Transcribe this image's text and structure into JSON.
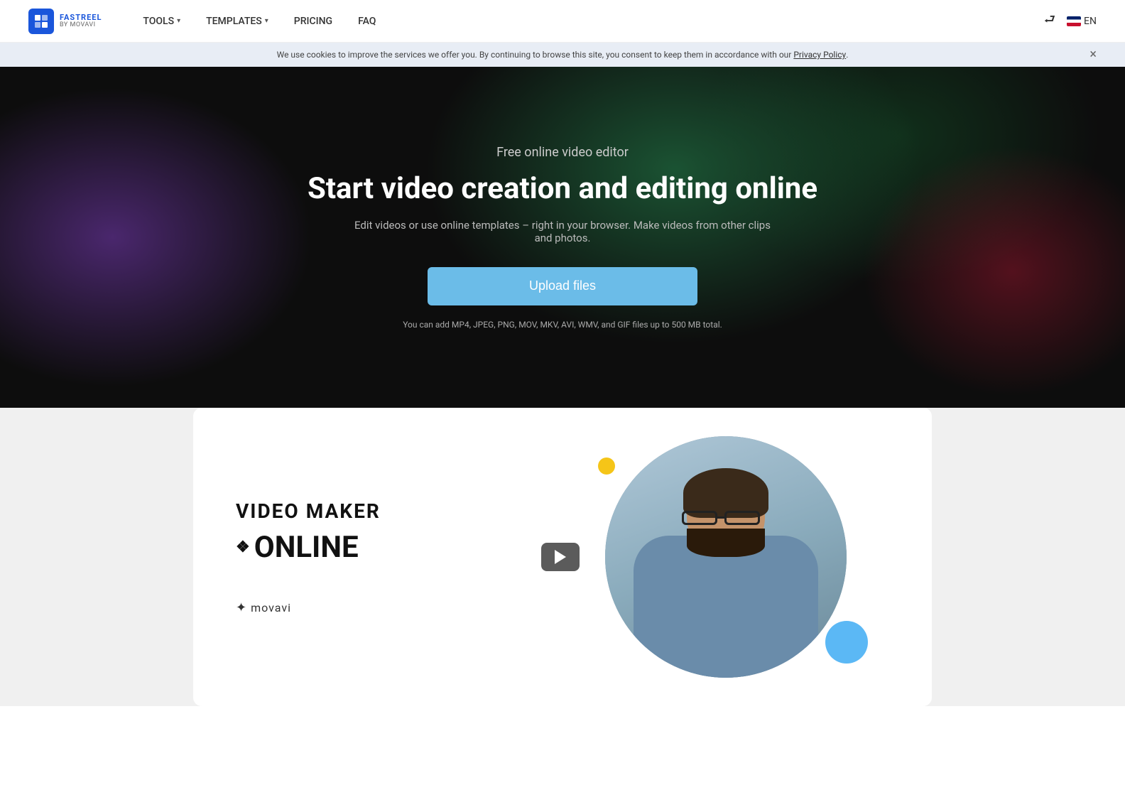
{
  "navbar": {
    "logo_top": "FASTREEL",
    "logo_bottom": "BY MOVAVI",
    "tools_label": "TOOLS",
    "templates_label": "TEMPLATES",
    "pricing_label": "PRICING",
    "faq_label": "FAQ",
    "login_label": "",
    "lang_label": "EN"
  },
  "cookie": {
    "text": "We use cookies to improve the services we offer you. By continuing to browse this site, you consent to keep them in accordance with our",
    "link_text": "Privacy Policy",
    "close_label": "×"
  },
  "hero": {
    "subtitle": "Free online video editor",
    "title": "Start video creation and editing online",
    "description": "Edit videos or use online templates – right in your browser. Make videos from other clips and photos.",
    "upload_button": "Upload files",
    "file_note": "You can add MP4, JPEG, PNG, MOV, MKV, AVI, WMV, and GIF files up to 500 MB total."
  },
  "video_card": {
    "maker_label": "VIDEO MAKER",
    "online_label": "ONLINE",
    "dots_icon": "❖",
    "movavi_dots": "✦",
    "movavi_label": "movavi",
    "play_label": "▶"
  },
  "decorations": {
    "yellow_dot_color": "#f5c518",
    "blue_dot_color": "#5bb8f5"
  }
}
